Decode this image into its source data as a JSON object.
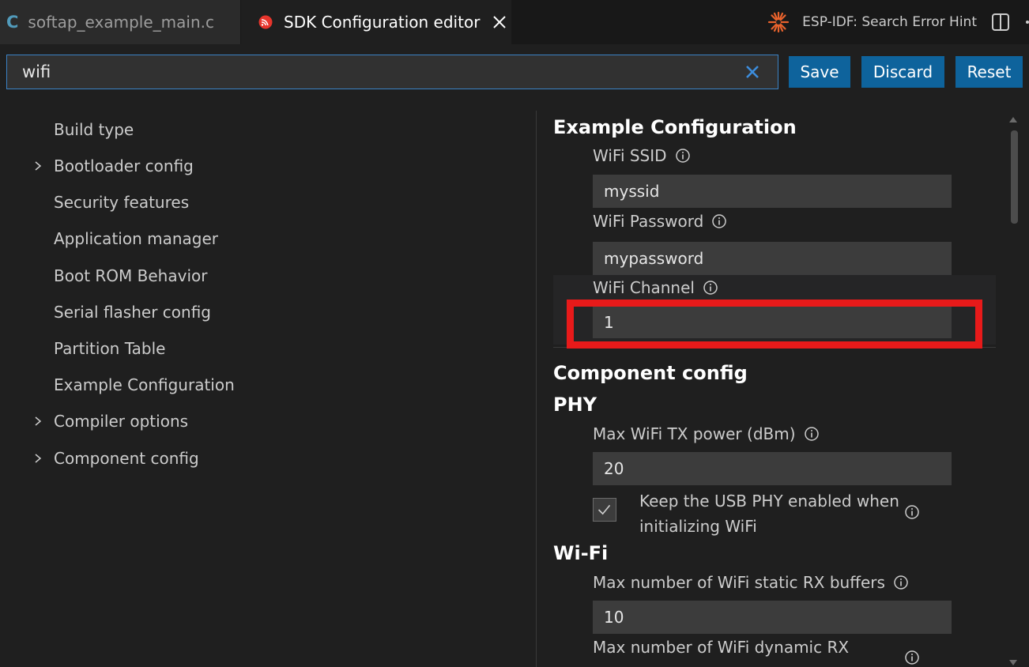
{
  "tabs": [
    {
      "label": "softap_example_main.c",
      "icon": "c-file-icon",
      "active": false
    },
    {
      "label": "SDK Configuration editor",
      "icon": "espressif-icon",
      "active": true
    }
  ],
  "header_actions": {
    "hint_label": "ESP-IDF: Search Error Hint"
  },
  "search": {
    "value": "wifi",
    "placeholder": ""
  },
  "buttons": {
    "save": "Save",
    "discard": "Discard",
    "reset": "Reset"
  },
  "sidebar": {
    "items": [
      {
        "label": "Build type",
        "expandable": false
      },
      {
        "label": "Bootloader config",
        "expandable": true
      },
      {
        "label": "Security features",
        "expandable": false
      },
      {
        "label": "Application manager",
        "expandable": false
      },
      {
        "label": "Boot ROM Behavior",
        "expandable": false
      },
      {
        "label": "Serial flasher config",
        "expandable": false
      },
      {
        "label": "Partition Table",
        "expandable": false
      },
      {
        "label": "Example Configuration",
        "expandable": false
      },
      {
        "label": "Compiler options",
        "expandable": true
      },
      {
        "label": "Component config",
        "expandable": true
      }
    ]
  },
  "main": {
    "example_config": {
      "title": "Example Configuration",
      "ssid": {
        "label": "WiFi SSID",
        "value": "myssid"
      },
      "password": {
        "label": "WiFi Password",
        "value": "mypassword"
      },
      "channel": {
        "label": "WiFi Channel",
        "value": "1"
      }
    },
    "component_config": {
      "title": "Component config"
    },
    "phy": {
      "title": "PHY",
      "tx_power": {
        "label": "Max WiFi TX power (dBm)",
        "value": "20"
      },
      "usb_phy": {
        "label": "Keep the USB PHY enabled when initializing WiFi",
        "checked": true
      }
    },
    "wifi": {
      "title": "Wi-Fi",
      "static_rx": {
        "label": "Max number of WiFi static RX buffers",
        "value": "10"
      },
      "dynamic_rx": {
        "label": "Max number of WiFi dynamic RX"
      }
    }
  },
  "colors": {
    "accent": "#0e639c",
    "highlight_box": "#e81a1a",
    "background": "#1f1f1f"
  }
}
